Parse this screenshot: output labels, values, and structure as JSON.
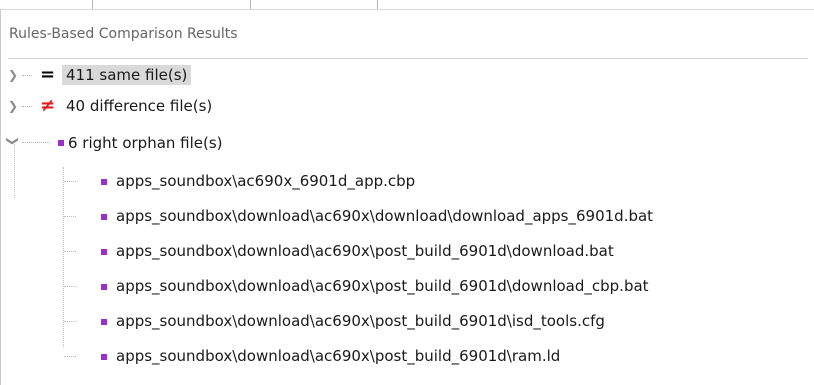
{
  "panel": {
    "title": "Rules-Based Comparison Results"
  },
  "tree": {
    "groups": [
      {
        "icon": "equal-sign-icon",
        "symbol": "=",
        "label": "411 same file(s)",
        "expanded": false,
        "selected": true
      },
      {
        "icon": "not-equal-sign-icon",
        "symbol": "≠",
        "label": "40 difference file(s)",
        "expanded": false,
        "selected": false
      },
      {
        "icon": "right-orphan-bullet-icon",
        "label": "6 right orphan file(s)",
        "expanded": true,
        "selected": false,
        "children": [
          "apps_soundbox\\ac690x_6901d_app.cbp",
          "apps_soundbox\\download\\ac690x\\download\\download_apps_6901d.bat",
          "apps_soundbox\\download\\ac690x\\post_build_6901d\\download.bat",
          "apps_soundbox\\download\\ac690x\\post_build_6901d\\download_cbp.bat",
          "apps_soundbox\\download\\ac690x\\post_build_6901d\\isd_tools.cfg",
          "apps_soundbox\\download\\ac690x\\post_build_6901d\\ram.ld"
        ]
      }
    ]
  },
  "colors": {
    "orphan_bullet": "#9b30c8",
    "difference_symbol": "#e02020",
    "selection_background": "#d9d9d9"
  }
}
